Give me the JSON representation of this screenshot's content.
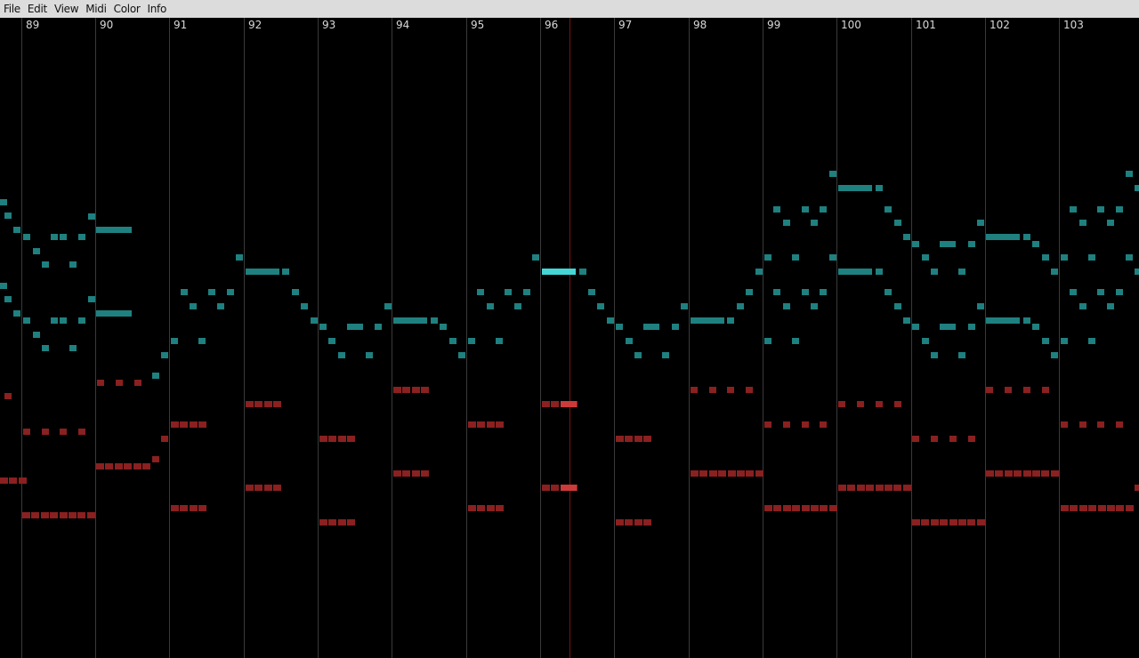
{
  "menu": {
    "items": [
      "File",
      "Edit",
      "View",
      "Midi",
      "Color",
      "Info"
    ]
  },
  "colors": {
    "menubar": "#dcdcdc",
    "background": "#000000",
    "bar_line": "#3a3a3a",
    "playhead": "#7a1212",
    "treble_note": "#1f8080",
    "treble_note_active": "#44d6d6",
    "bass_note": "#8a2020",
    "bass_note_active": "#cc3a3a"
  },
  "measures": [
    "89",
    "90",
    "91",
    "92",
    "93",
    "94",
    "95",
    "96",
    "97",
    "98",
    "99",
    "100",
    "101",
    "102",
    "103"
  ]
}
